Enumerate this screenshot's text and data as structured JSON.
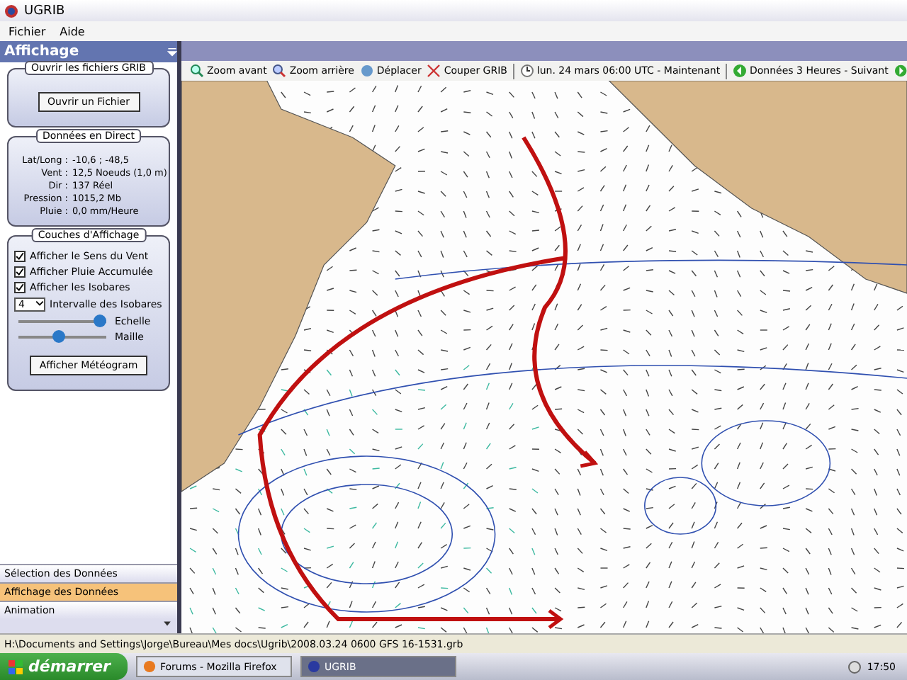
{
  "window": {
    "title": "UGRIB"
  },
  "menu": [
    "Fichier",
    "Aide"
  ],
  "panel": {
    "title": "Affichage",
    "open_group": {
      "title": "Ouvrir les fichiers GRIB",
      "button": "Ouvrir un Fichier"
    },
    "live_group": {
      "title": "Données en Direct",
      "rows": [
        {
          "label": "Lat/Long :",
          "value": "-10,6 ; -48,5"
        },
        {
          "label": "Vent :",
          "value": "12,5 Noeuds (1,0 m)"
        },
        {
          "label": "Dir :",
          "value": "137 Réel"
        },
        {
          "label": "Pression :",
          "value": "1015,2 Mb"
        },
        {
          "label": "Pluie :",
          "value": "0,0 mm/Heure"
        }
      ]
    },
    "layers_group": {
      "title": "Couches d'Affichage",
      "options": [
        {
          "label": "Afficher le Sens du Vent",
          "checked": true
        },
        {
          "label": "Afficher Pluie Accumulée",
          "checked": true
        },
        {
          "label": "Afficher les Isobares",
          "checked": true
        }
      ],
      "interval": {
        "value": "4",
        "label": "Intervalle des Isobares"
      },
      "sliders": [
        {
          "label": "Echelle",
          "level": 0.92
        },
        {
          "label": "Maille",
          "level": 0.45
        }
      ],
      "button": "Afficher Météogram"
    },
    "nav": [
      {
        "label": "Sélection des Données",
        "selected": false
      },
      {
        "label": "Affichage des Données",
        "selected": true
      },
      {
        "label": "Animation",
        "selected": false
      }
    ]
  },
  "toolbar": [
    {
      "kind": "zoomin",
      "label": "Zoom avant"
    },
    {
      "kind": "zoomout",
      "label": "Zoom arrière"
    },
    {
      "kind": "move",
      "label": "Déplacer"
    },
    {
      "kind": "cut",
      "label": "Couper GRIB"
    },
    {
      "kind": "sep"
    },
    {
      "kind": "clock",
      "label": "lun. 24 mars 06:00 UTC - Maintenant"
    },
    {
      "kind": "sep"
    },
    {
      "kind": "prev",
      "label": "Données 3 Heures - Suivant"
    },
    {
      "kind": "next"
    }
  ],
  "status_bar": "H:\\Documents and Settings\\Jorge\\Bureau\\Mes docs\\Ugrib\\2008.03.24 0600 GFS 16-1531.grb",
  "taskbar": {
    "start": "démarrer",
    "tasks": [
      {
        "label": "Forums - Mozilla Firefox",
        "selected": false
      },
      {
        "label": "UGRIB",
        "selected": true
      }
    ],
    "clock": "17:50"
  }
}
